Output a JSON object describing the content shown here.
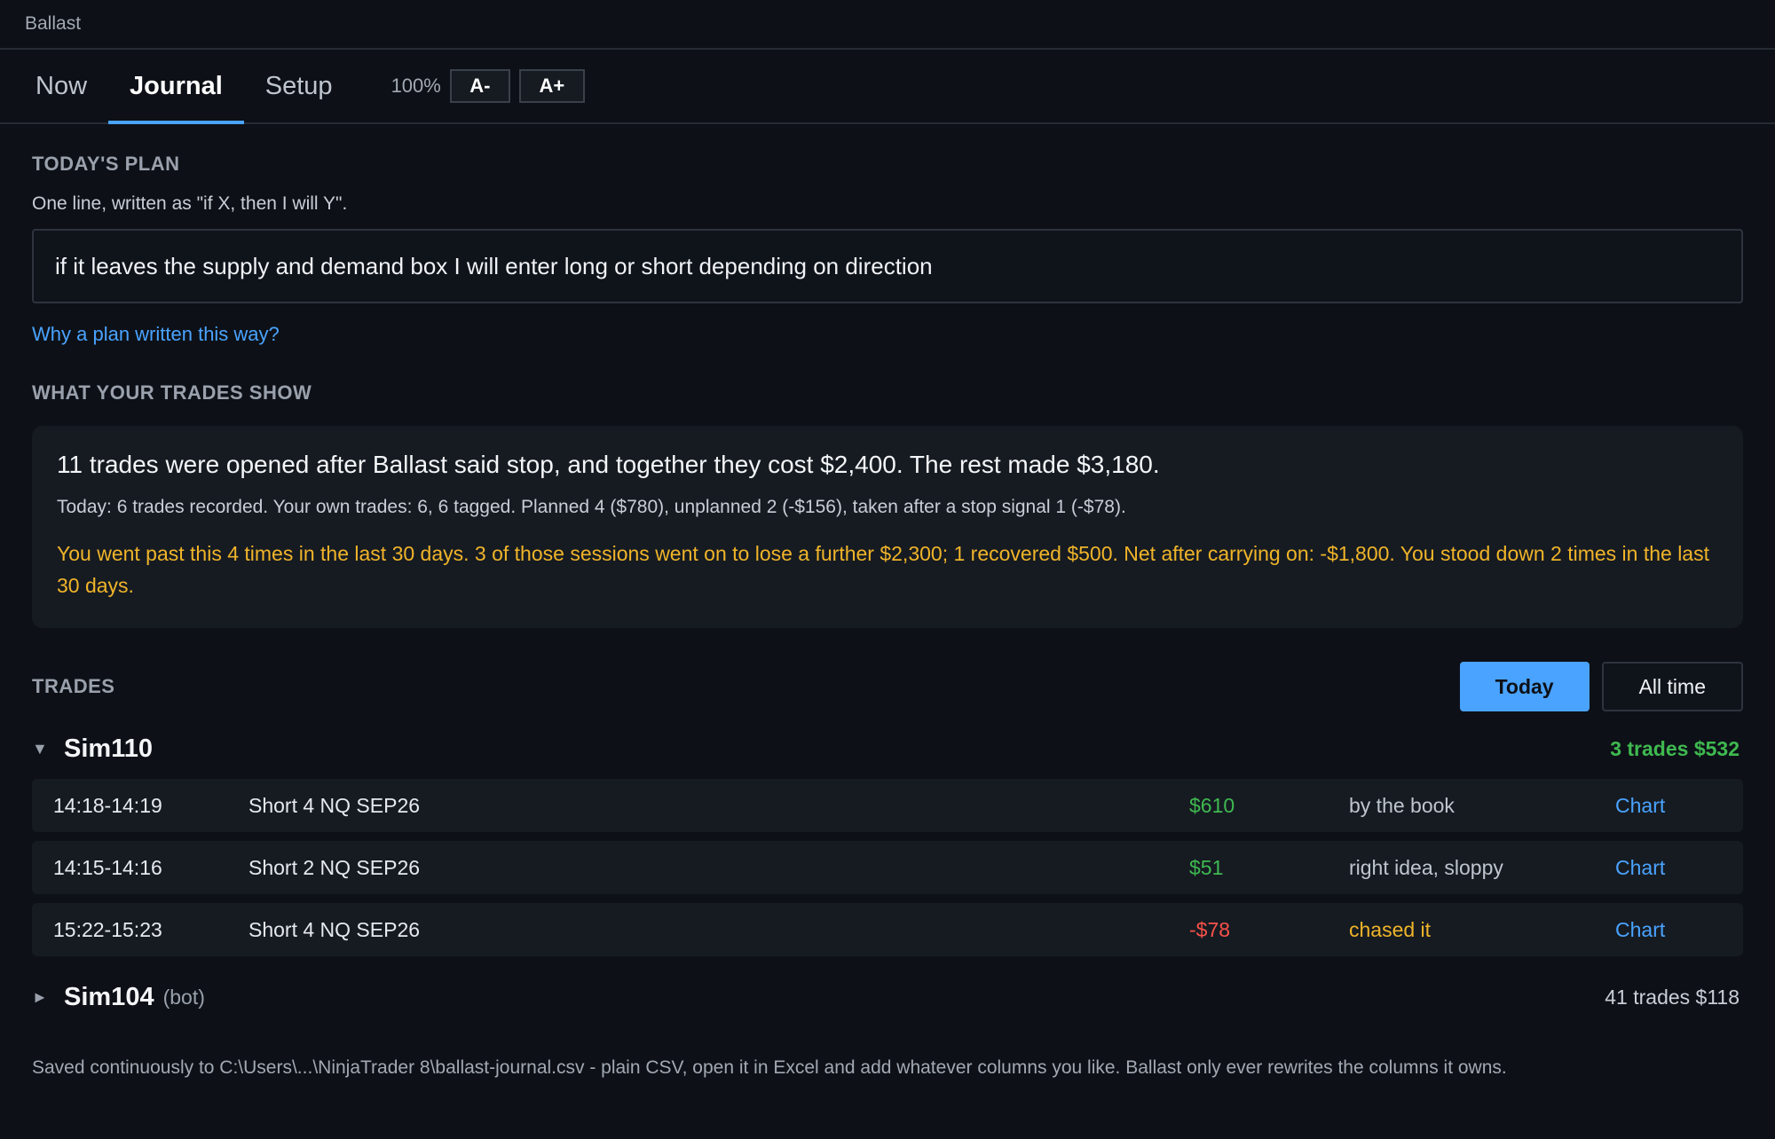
{
  "window": {
    "title": "Ballast"
  },
  "tabs": [
    {
      "label": "Now"
    },
    {
      "label": "Journal"
    },
    {
      "label": "Setup"
    }
  ],
  "zoom": {
    "level": "100%",
    "decrease_label": "A-",
    "increase_label": "A+"
  },
  "plan": {
    "heading": "TODAY'S PLAN",
    "hint": "One line, written as \"if X, then I will Y\".",
    "value": "if it leaves the supply and demand box I will enter long or short depending on direction",
    "link": "Why a plan written this way?"
  },
  "insights": {
    "heading": "WHAT YOUR TRADES SHOW",
    "headline": "11 trades were opened after Ballast said stop, and together they cost $2,400. The rest made $3,180.",
    "today": "Today: 6 trades recorded. Your own trades: 6, 6 tagged. Planned 4 ($780), unplanned 2 (-$156), taken after a stop signal 1 (-$78).",
    "warning": "You went past this 4 times in the last 30 days. 3 of those sessions went on to lose a further $2,300; 1 recovered $500. Net after carrying on: -$1,800. You stood down 2 times in the last 30 days."
  },
  "trades": {
    "heading": "TRADES",
    "filter_today": "Today",
    "filter_all": "All time",
    "accounts": [
      {
        "caret": "▼",
        "name": "Sim110",
        "sub": "",
        "summary": "3 trades $532",
        "rows": [
          {
            "time": "14:18-14:19",
            "desc": "Short 4 NQ SEP26",
            "pnl": "$610",
            "tag": "by the book",
            "chart": "Chart"
          },
          {
            "time": "14:15-14:16",
            "desc": "Short 2 NQ SEP26",
            "pnl": "$51",
            "tag": "right idea, sloppy",
            "chart": "Chart"
          },
          {
            "time": "15:22-15:23",
            "desc": "Short 4 NQ SEP26",
            "pnl": "-$78",
            "tag": "chased it",
            "chart": "Chart"
          }
        ]
      },
      {
        "caret": "►",
        "name": "Sim104",
        "sub": "(bot)",
        "summary": "41 trades $118"
      }
    ]
  },
  "footer": "Saved continuously to C:\\Users\\...\\NinjaTrader 8\\ballast-journal.csv - plain CSV, open it in Excel and add whatever columns you like. Ballast only ever rewrites the columns it owns.",
  "colors": {
    "accent": "#4aa3ff",
    "positive": "#3fb950",
    "negative": "#f85149",
    "warning": "#f0b429",
    "background": "#0d1117"
  }
}
